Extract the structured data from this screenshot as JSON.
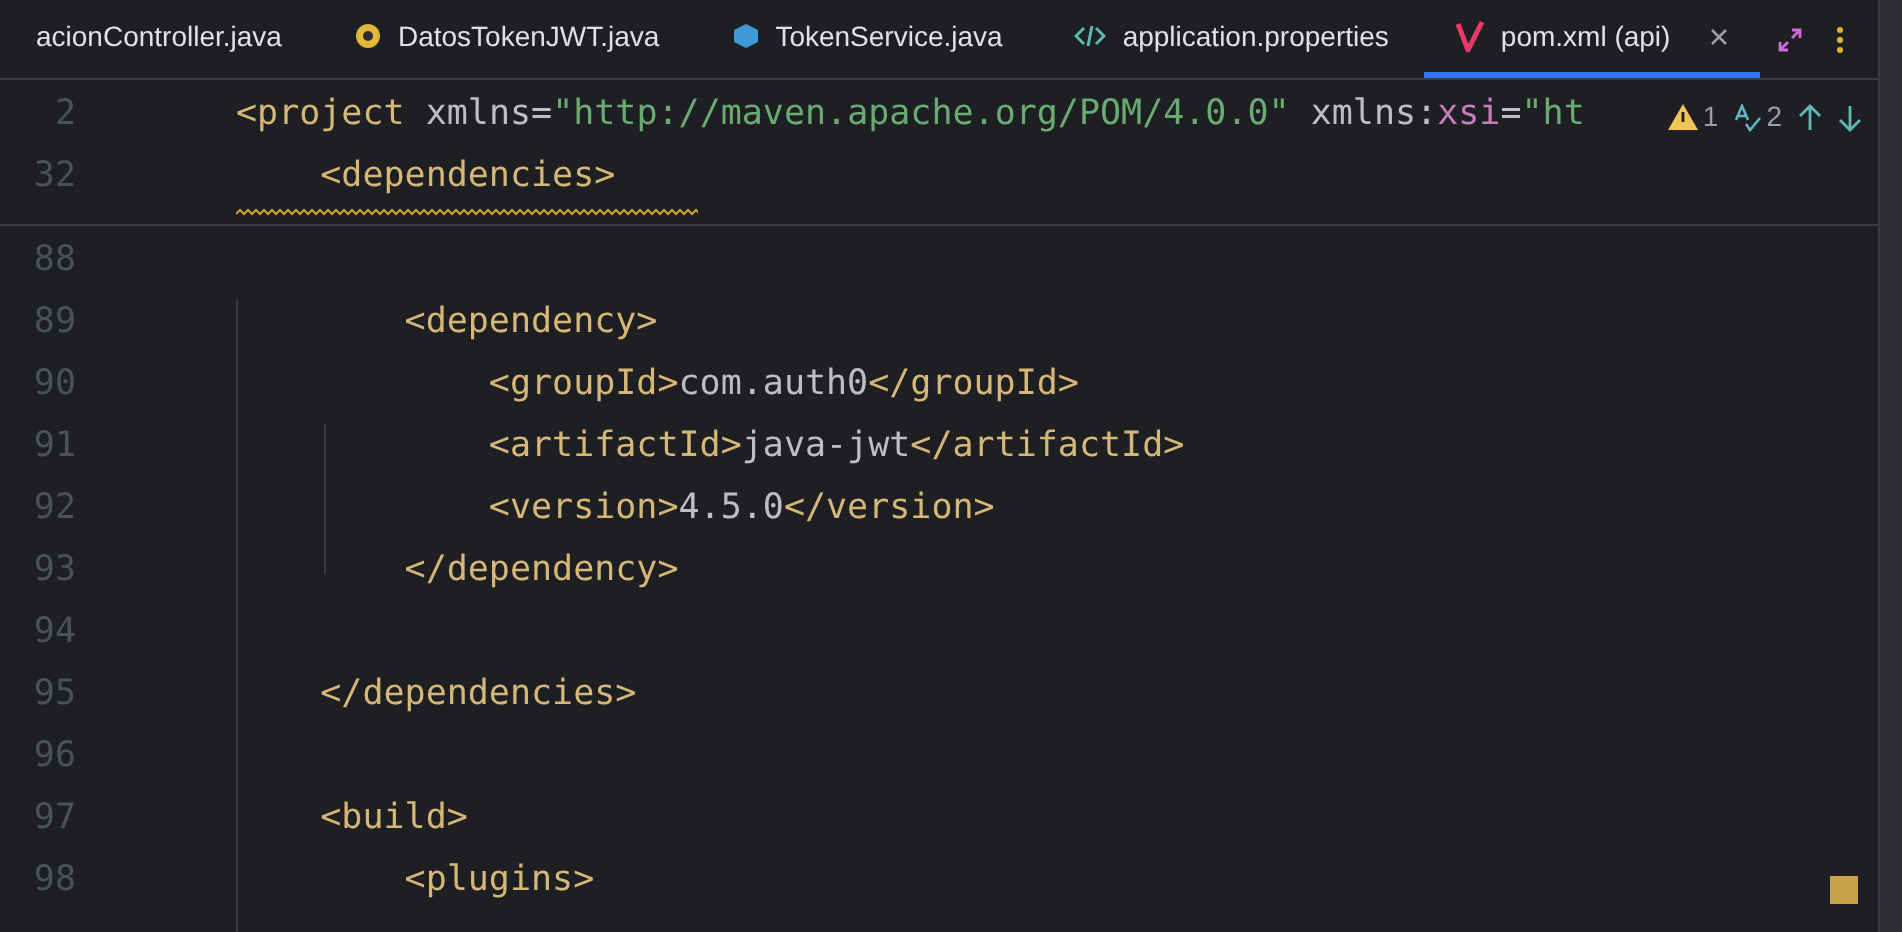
{
  "tabs": [
    {
      "label": "acionController.java",
      "selected": false,
      "kind": "plain"
    },
    {
      "label": "DatosTokenJWT.java",
      "selected": false,
      "kind": "record"
    },
    {
      "label": "TokenService.java",
      "selected": false,
      "kind": "class"
    },
    {
      "label": "application.properties",
      "selected": false,
      "kind": "properties"
    },
    {
      "label": "pom.xml (api)",
      "selected": true,
      "kind": "maven"
    }
  ],
  "inspections": {
    "warnings": "1",
    "typos": "2"
  },
  "sticky_lines": [
    {
      "number": "2",
      "tokens": [
        {
          "kind": "tag",
          "text": "<project"
        },
        {
          "kind": "attr",
          "text": " xmlns"
        },
        {
          "kind": "plain",
          "text": "="
        },
        {
          "kind": "string",
          "text": "\"http://maven.apache.org/POM/4.0.0\""
        },
        {
          "kind": "attr",
          "text": " xmlns:"
        },
        {
          "kind": "ns",
          "text": "xsi"
        },
        {
          "kind": "plain",
          "text": "="
        },
        {
          "kind": "string",
          "text": "\"ht"
        }
      ]
    },
    {
      "number": "32",
      "tokens": [
        {
          "kind": "tag",
          "text": "    <dependencies>"
        }
      ]
    }
  ],
  "lines": [
    {
      "number": "88"
    },
    {
      "number": "89",
      "tokens": [
        {
          "kind": "tag",
          "text": "        <dependency>"
        }
      ]
    },
    {
      "number": "90",
      "tokens": [
        {
          "kind": "tag",
          "text": "            <groupId>"
        },
        {
          "kind": "plain",
          "text": "com.auth0"
        },
        {
          "kind": "tag",
          "text": "</groupId>"
        }
      ]
    },
    {
      "number": "91",
      "tokens": [
        {
          "kind": "tag",
          "text": "            <artifactId>"
        },
        {
          "kind": "plain",
          "text": "java-jwt"
        },
        {
          "kind": "tag",
          "text": "</artifactId>"
        }
      ]
    },
    {
      "number": "92",
      "tokens": [
        {
          "kind": "tag",
          "text": "            <version>"
        },
        {
          "kind": "plain",
          "text": "4.5.0"
        },
        {
          "kind": "tag",
          "text": "</version>"
        }
      ]
    },
    {
      "number": "93",
      "tokens": [
        {
          "kind": "tag",
          "text": "        </dependency>"
        }
      ]
    },
    {
      "number": "94"
    },
    {
      "number": "95",
      "tokens": [
        {
          "kind": "tag",
          "text": "    </dependencies>"
        }
      ]
    },
    {
      "number": "96"
    },
    {
      "number": "97",
      "tokens": [
        {
          "kind": "tag",
          "text": "    <build>"
        }
      ]
    },
    {
      "number": "98",
      "tokens": [
        {
          "kind": "tag",
          "text": "        <plugins>"
        }
      ]
    }
  ]
}
